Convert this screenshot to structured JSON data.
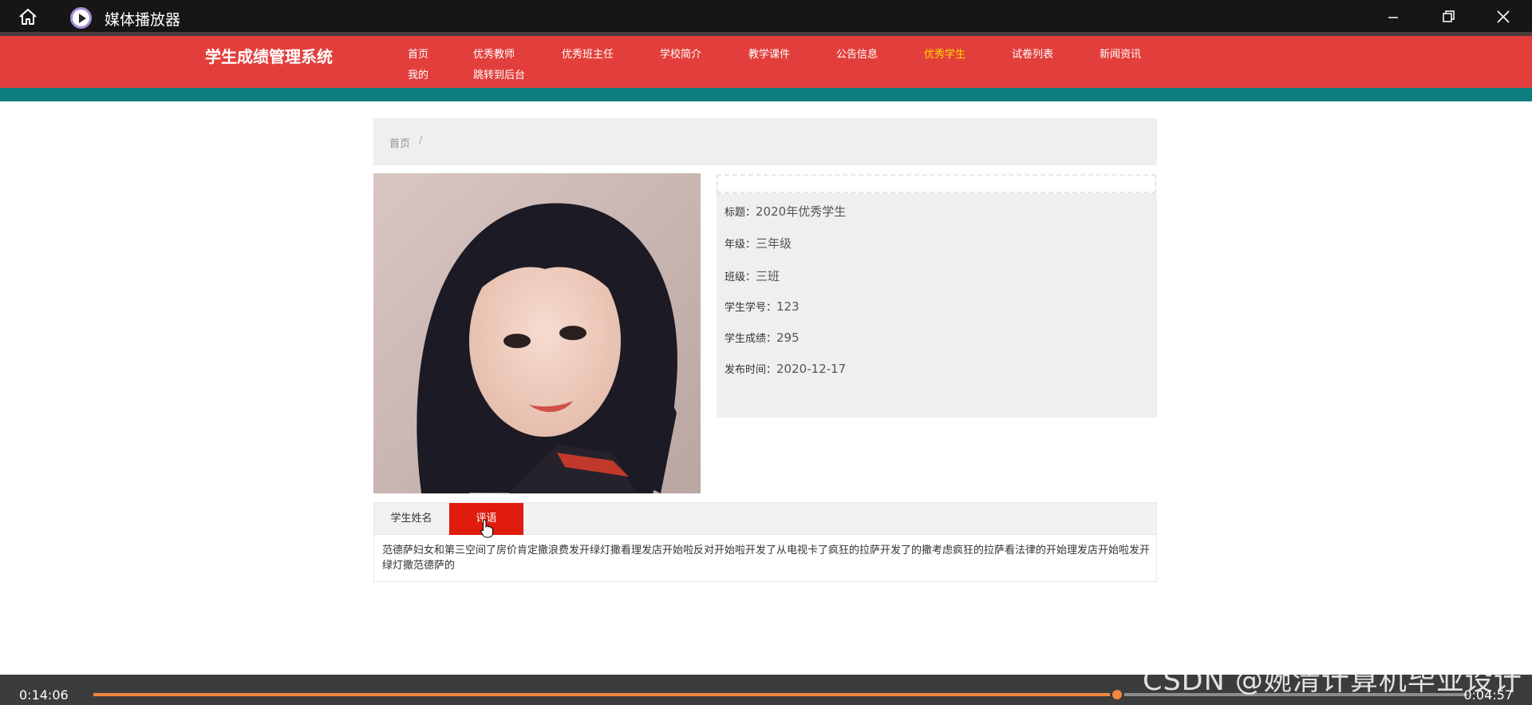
{
  "player": {
    "title": "媒体播放器",
    "elapsed": "0:14:06",
    "remaining": "0:04:57",
    "progress_fraction": 0.745
  },
  "site": {
    "brand": "学生成绩管理系统",
    "nav": [
      {
        "label": "首页",
        "active": false
      },
      {
        "label": "优秀教师",
        "active": false
      },
      {
        "label": "优秀班主任",
        "active": false
      },
      {
        "label": "学校简介",
        "active": false
      },
      {
        "label": "教学课件",
        "active": false
      },
      {
        "label": "公告信息",
        "active": false
      },
      {
        "label": "优秀学生",
        "active": true
      },
      {
        "label": "试卷列表",
        "active": false
      },
      {
        "label": "新闻资讯",
        "active": false
      },
      {
        "label": "我的",
        "active": false
      },
      {
        "label": "跳转到后台",
        "active": false
      }
    ],
    "active_color": "#ffd700",
    "header_color": "#e23f3c",
    "band_color": "#0f7e7e"
  },
  "breadcrumb": {
    "home": "首页",
    "separator": "/"
  },
  "detail": {
    "fields": [
      {
        "label": "标题：",
        "value": "2020年优秀学生"
      },
      {
        "label": "年级：",
        "value": "三年级"
      },
      {
        "label": "班级：",
        "value": "三班"
      },
      {
        "label": "学生学号：",
        "value": "123"
      },
      {
        "label": "学生成绩：",
        "value": "295"
      },
      {
        "label": "发布时间：",
        "value": "2020-12-17"
      }
    ]
  },
  "tabs": {
    "items": [
      {
        "label": "学生姓名",
        "active": false
      },
      {
        "label": "评语",
        "active": true
      }
    ],
    "active_color": "#e01c0f",
    "content": "范德萨妇女和第三空间了房价肯定撒浪费发开绿灯撒看理发店开始啦反对开始啦开发了从电视卡了疯狂的拉萨开发了的撒考虑疯狂的拉萨看法律的开始理发店开始啦发开绿灯撒范德萨的"
  },
  "watermark": "CSDN @婉清计算机毕业设计"
}
